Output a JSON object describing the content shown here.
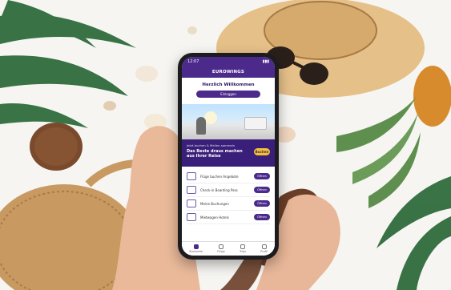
{
  "colors": {
    "brand": "#4b2a8c",
    "promo_bg": "#3a1f7a",
    "cta": "#f2c230"
  },
  "phone": {
    "status": {
      "time": "12:07",
      "icons": "▮▮▮"
    },
    "app_title": "EUROWINGS",
    "welcome": {
      "title": "Herzlich Willkommen",
      "button": "Einloggen"
    },
    "promo": {
      "small": "Jetzt buchen & Meilen sammeln",
      "headline": "Das Beste draus machen aus Ihrer Reise",
      "cta": "Buchen"
    },
    "list_items": [
      {
        "label": "Flüge buchen Angebote",
        "button": "Öffnen"
      },
      {
        "label": "Check-in Boarding Pass",
        "button": "Öffnen"
      },
      {
        "label": "Meine Buchungen",
        "button": "Öffnen"
      },
      {
        "label": "Mietwagen Hotels",
        "button": "Öffnen"
      }
    ],
    "tabs": [
      {
        "label": "Startseite",
        "icon": "home-icon"
      },
      {
        "label": "Flüge",
        "icon": "plane-icon"
      },
      {
        "label": "Trips",
        "icon": "briefcase-icon"
      },
      {
        "label": "Profil",
        "icon": "user-icon"
      }
    ]
  }
}
